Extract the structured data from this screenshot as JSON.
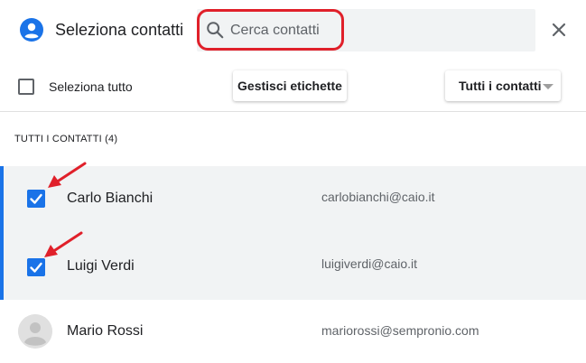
{
  "header": {
    "title": "Seleziona contatti",
    "account_icon": "account-circle-icon",
    "search_icon": "search-icon",
    "close_icon": "close-icon"
  },
  "search": {
    "placeholder": "Cerca contatti",
    "value": ""
  },
  "toolbar": {
    "select_all_label": "Seleziona tutto",
    "manage_labels_button": "Gestisci etichette",
    "filter_dropdown": "Tutti i contatti"
  },
  "section": {
    "title": "TUTTI I CONTATTI (4)"
  },
  "contacts": [
    {
      "name": "Carlo Bianchi",
      "email": "carlobianchi@caio.it",
      "selected": true
    },
    {
      "name": "Luigi Verdi",
      "email": "luigiverdi@caio.it",
      "selected": true
    },
    {
      "name": "Mario Rossi",
      "email": "mariorossi@sempronio.com",
      "selected": false
    }
  ],
  "colors": {
    "accent": "#1a73e8",
    "highlight": "#e0202a",
    "selected_row_bg": "#f1f3f4"
  }
}
